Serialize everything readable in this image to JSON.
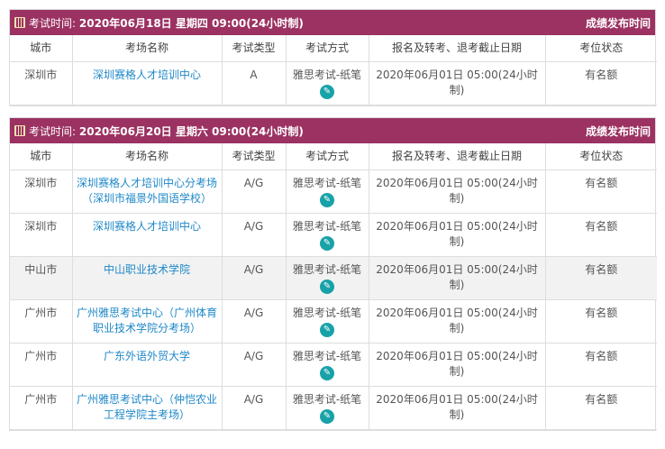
{
  "columns": [
    "城市",
    "考场名称",
    "考试类型",
    "考试方式",
    "报名及转考、退考截止日期",
    "考位状态"
  ],
  "sessions": [
    {
      "label": "考试时间:",
      "time": "2020年06月18日 星期四 09:00(24小时制)",
      "right": "成绩发布时间",
      "rows": [
        {
          "city": "深圳市",
          "venue": "深圳赛格人才培训中心",
          "type": "A",
          "mode": "雅思考试-纸笔",
          "deadline": "2020年06月01日 05:00(24小时制)",
          "status": "有名额"
        }
      ]
    },
    {
      "label": "考试时间:",
      "time": "2020年06月20日 星期六 09:00(24小时制)",
      "right": "成绩发布时间",
      "rows": [
        {
          "city": "深圳市",
          "venue": "深圳赛格人才培训中心分考场（深圳市福景外国语学校）",
          "type": "A/G",
          "mode": "雅思考试-纸笔",
          "deadline": "2020年06月01日 05:00(24小时制)",
          "status": "有名额"
        },
        {
          "city": "深圳市",
          "venue": "深圳赛格人才培训中心",
          "type": "A/G",
          "mode": "雅思考试-纸笔",
          "deadline": "2020年06月01日 05:00(24小时制)",
          "status": "有名额"
        },
        {
          "city": "中山市",
          "venue": "中山职业技术学院",
          "type": "A/G",
          "mode": "雅思考试-纸笔",
          "deadline": "2020年06月01日 05:00(24小时制)",
          "status": "有名额"
        },
        {
          "city": "广州市",
          "venue": "广州雅思考试中心（广州体育职业技术学院分考场）",
          "type": "A/G",
          "mode": "雅思考试-纸笔",
          "deadline": "2020年06月01日 05:00(24小时制)",
          "status": "有名额"
        },
        {
          "city": "广州市",
          "venue": "广东外语外贸大学",
          "type": "A/G",
          "mode": "雅思考试-纸笔",
          "deadline": "2020年06月01日 05:00(24小时制)",
          "status": "有名额"
        },
        {
          "city": "广州市",
          "venue": "广州雅思考试中心（仲恺农业工程学院主考场）",
          "type": "A/G",
          "mode": "雅思考试-纸笔",
          "deadline": "2020年06月01日 05:00(24小时制)",
          "status": "有名额"
        }
      ]
    }
  ]
}
